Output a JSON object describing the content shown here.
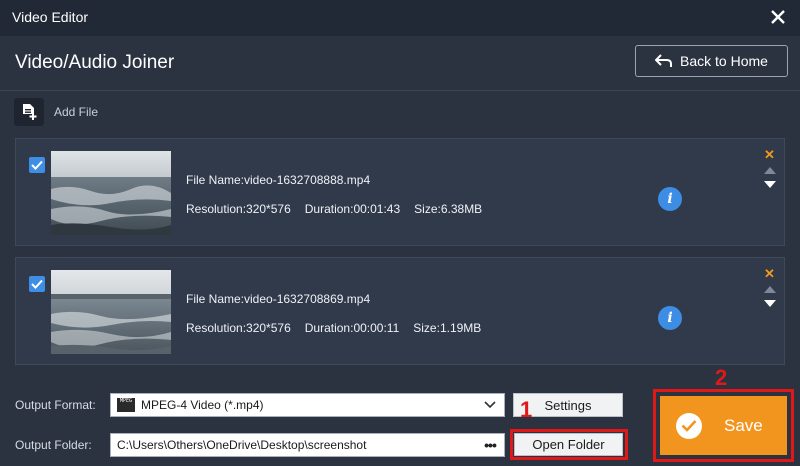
{
  "window": {
    "title": "Video Editor"
  },
  "header": {
    "title": "Video/Audio Joiner",
    "back_label": "Back to Home"
  },
  "toolbar": {
    "add_file_label": "Add File"
  },
  "files": [
    {
      "checked": true,
      "name": "File Name:video-1632708888.mp4",
      "resolution": "Resolution:320*576",
      "duration": "Duration:00:01:43",
      "size": "Size:6.38MB",
      "info": "i"
    },
    {
      "checked": true,
      "name": "File Name:video-1632708869.mp4",
      "resolution": "Resolution:320*576",
      "duration": "Duration:00:00:11",
      "size": "Size:1.19MB",
      "info": "i"
    }
  ],
  "output": {
    "format_label": "Output Format:",
    "format_value": "MPEG-4 Video (*.mp4)",
    "format_icon_text": "MPEG",
    "settings_label": "Settings",
    "folder_label": "Output Folder:",
    "folder_value": "C:\\Users\\Others\\OneDrive\\Desktop\\screenshot",
    "browse_label": "•••",
    "open_folder_label": "Open Folder"
  },
  "save": {
    "label": "Save"
  },
  "annotations": {
    "step1": "1",
    "step2": "2"
  },
  "colors": {
    "accent_orange": "#f2951f",
    "checkbox_blue": "#3e8ee6",
    "highlight_red": "#e01818",
    "background": "#2b3341"
  }
}
